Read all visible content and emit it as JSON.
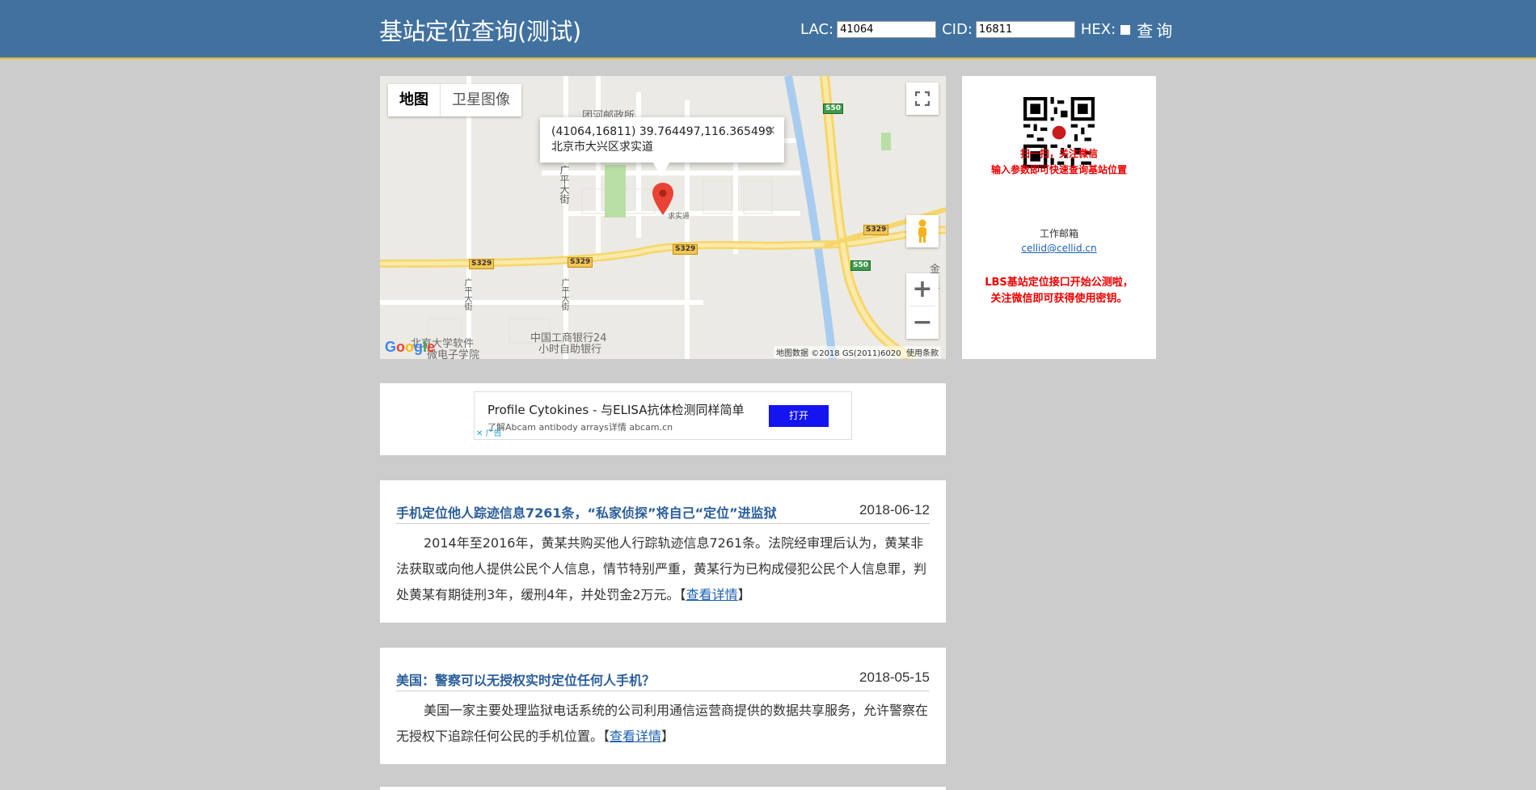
{
  "header": {
    "title": "基站定位查询(测试)",
    "lac_label": "LAC:",
    "lac_value": "41064",
    "cid_label": "CID:",
    "cid_value": "16811",
    "hex_label": "HEX:",
    "query_button": "查询"
  },
  "map": {
    "type_map": "地图",
    "type_satellite": "卫星图像",
    "info_line1": "(41064,16811) 39.764497,116.365499",
    "info_line2": "北京市大兴区求实道",
    "info_close": "×",
    "attribution": "地图数据 ©2018 GS(2011)6020",
    "terms": "使用条款",
    "google": "Google",
    "zoom_in": "+",
    "zoom_out": "−",
    "labels": {
      "post_office": "团河邮政所",
      "guangping1": "广平大街",
      "guangping2": "广平大街",
      "guangping3": "广平大街",
      "pku": "北京大学软件",
      "pku2": "微电子学院",
      "icbc": "中国工商银行24",
      "icbc2": "小时自助银行",
      "qiushi": "求实道",
      "jin": "金星"
    },
    "shields": {
      "s50a": "S50",
      "s50b": "S50",
      "s329a": "S329",
      "s329b": "S329",
      "s329c": "S329",
      "s329d": "S329"
    }
  },
  "sidebar": {
    "scan_line1": "扫一扫，关注微信",
    "scan_line2": "输入参数即可快速查询基站位置",
    "email_label": "工作邮箱",
    "email": "cellid@cellid.cn",
    "lbs_line1": "LBS基站定位接口开始公测啦，",
    "lbs_line2": "关注微信即可获得使用密钥。"
  },
  "ad": {
    "title": "Profile Cytokines - 与ELISA抗体检测同样简单",
    "subtitle": "了解Abcam antibody arrays详情 abcam.cn",
    "button": "打开",
    "badge": "✕ 广告"
  },
  "news": [
    {
      "title": "手机定位他人踪迹信息7261条，“私家侦探”将自己“定位”进监狱",
      "date": "2018-06-12",
      "body": "2014年至2016年，黄某共购买他人行踪轨迹信息7261条。法院经审理后认为，黄某非法获取或向他人提供公民个人信息，情节特别严重，黄某行为已构成侵犯公民个人信息罪，判处黄某有期徒刑3年，缓刑4年，并处罚金2万元。",
      "link": "查看详情"
    },
    {
      "title": "美国：警察可以无授权实时定位任何人手机？",
      "date": "2018-05-15",
      "body": "美国一家主要处理监狱电话系统的公司利用通信运营商提供的数据共享服务，允许警察在无授权下追踪任何公民的手机位置。",
      "link": "查看详情"
    }
  ],
  "colors": {
    "header_bg": "#41719f",
    "accent_line": "#e1b92a",
    "news_title": "#2a5e9b",
    "sidebar_red": "#ee0000",
    "ad_button": "#1414f0"
  }
}
